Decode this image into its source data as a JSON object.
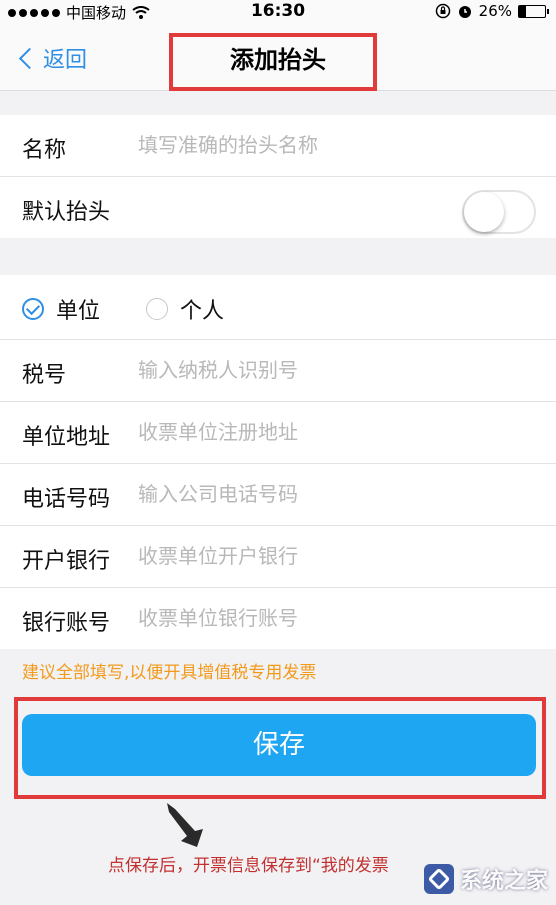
{
  "status_bar": {
    "carrier": "中国移动",
    "time": "16:30",
    "battery": "26%",
    "battery_level": 0.26
  },
  "nav": {
    "back_label": "返回",
    "title": "添加抬头"
  },
  "section1": {
    "name_label": "名称",
    "name_placeholder": "填写准确的抬头名称",
    "default_label": "默认抬头",
    "default_on": false
  },
  "section2": {
    "type_options": [
      {
        "label": "单位",
        "checked": true
      },
      {
        "label": "个人",
        "checked": false
      }
    ],
    "fields": [
      {
        "label": "税号",
        "placeholder": "输入纳税人识别号"
      },
      {
        "label": "单位地址",
        "placeholder": "收票单位注册地址"
      },
      {
        "label": "电话号码",
        "placeholder": "输入公司电话号码"
      },
      {
        "label": "开户银行",
        "placeholder": "收票单位开户银行"
      },
      {
        "label": "银行账号",
        "placeholder": "收票单位银行账号"
      }
    ]
  },
  "tip": "建议全部填写,以便开具增值税专用发票",
  "save_label": "保存",
  "annotation": "点保存后，开票信息保存到“我的发票",
  "watermark": "系统之家",
  "colors": {
    "accent": "#2f8fe6",
    "save": "#1ea6f2",
    "tip": "#f29a1c",
    "highlight": "#e03a3a"
  }
}
